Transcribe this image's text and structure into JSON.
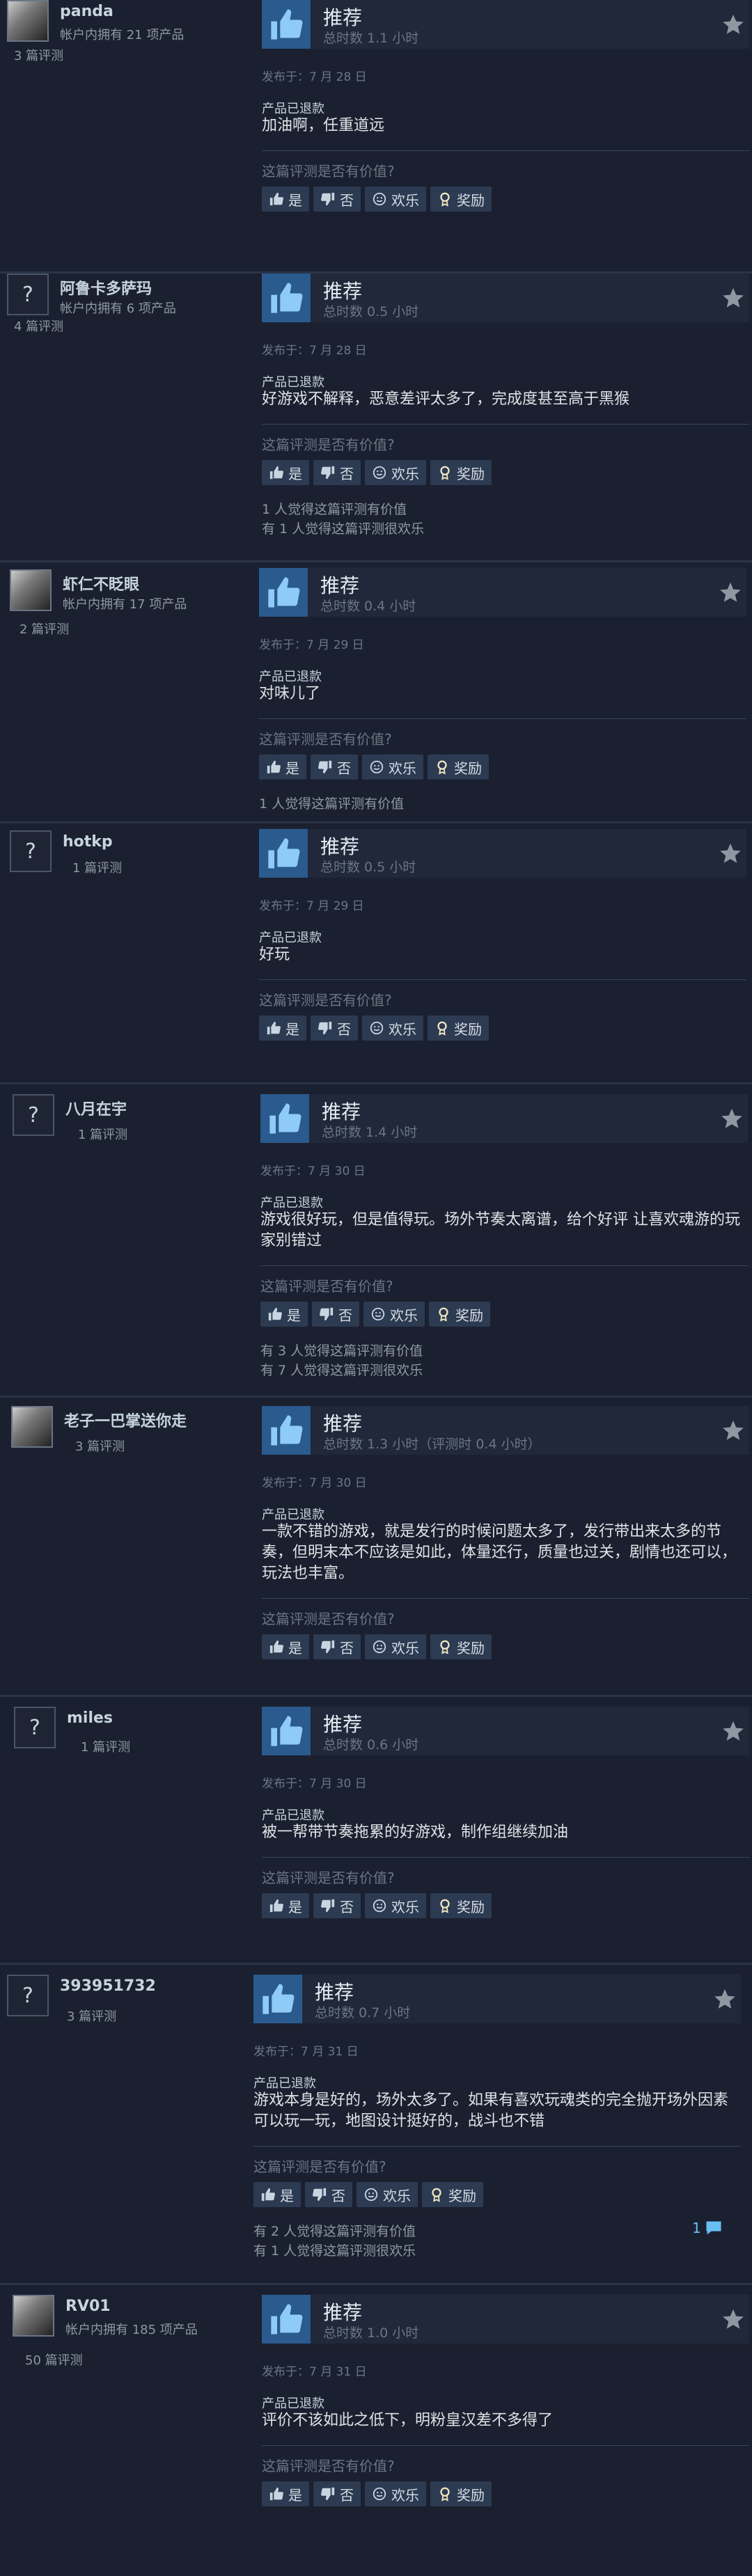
{
  "common": {
    "recommend": "推荐",
    "refunded": "产品已退款",
    "help_question": "这篇评测是否有价值?",
    "btn_yes": "是",
    "btn_no": "否",
    "btn_funny": "欢乐",
    "btn_award": "奖励"
  },
  "reviews": [
    {
      "username": "panda",
      "products": "帐户内拥有 21 项产品",
      "review_count": "3 篇评测",
      "hours": "总时数 1.1 小时",
      "date": "发布于：7 月 28 日",
      "body": "加油啊，任重道远",
      "stats": [],
      "avatar": "animal"
    },
    {
      "username": "阿鲁卡多萨玛",
      "products": "帐户内拥有 6 项产品",
      "review_count": "4 篇评测",
      "hours": "总时数 0.5 小时",
      "date": "发布于：7 月 28 日",
      "body": "好游戏不解释，恶意差评太多了，完成度甚至高于黑猴",
      "stats": [
        "1 人觉得这篇评测有价值",
        "有 1 人觉得这篇评测很欢乐"
      ],
      "avatar": "default"
    },
    {
      "username": "虾仁不眨眼",
      "products": "帐户内拥有 17 项产品",
      "review_count": "2 篇评测",
      "hours": "总时数 0.4 小时",
      "date": "发布于：7 月 29 日",
      "body": "对味儿了",
      "stats": [
        "1 人觉得这篇评测有价值"
      ],
      "avatar": "photo"
    },
    {
      "username": "hotkp",
      "products": "",
      "review_count": "1 篇评测",
      "hours": "总时数 0.5 小时",
      "date": "发布于：7 月 29 日",
      "body": "好玩",
      "stats": [],
      "avatar": "default"
    },
    {
      "username": "八月在宇",
      "products": "",
      "review_count": "1 篇评测",
      "hours": "总时数 1.4 小时",
      "date": "发布于：7 月 30 日",
      "body": "游戏很好玩，但是值得玩。场外节奏太离谱，给个好评 让喜欢魂游的玩家别错过",
      "stats": [
        "有 3 人觉得这篇评测有价值",
        "有 7 人觉得这篇评测很欢乐"
      ],
      "avatar": "default"
    },
    {
      "username": "老子一巴掌送你走",
      "products": "",
      "review_count": "3 篇评测",
      "hours": "总时数 1.3 小时（评测时 0.4 小时）",
      "date": "发布于：7 月 30 日",
      "body": "一款不错的游戏，就是发行的时候问题太多了，发行带出来太多的节奏，但明末本不应该是如此，体量还行，质量也过关，剧情也还可以，玩法也丰富。",
      "stats": [],
      "avatar": "animal"
    },
    {
      "username": "miles",
      "products": "",
      "review_count": "1 篇评测",
      "hours": "总时数 0.6 小时",
      "date": "发布于：7 月 30 日",
      "body": "被一帮带节奏拖累的好游戏，制作组继续加油",
      "stats": [],
      "avatar": "default"
    },
    {
      "username": "393951732",
      "products": "",
      "review_count": "3 篇评测",
      "hours": "总时数 0.7 小时",
      "date": "发布于：7 月 31 日",
      "body": "游戏本身是好的，场外太多了。如果有喜欢玩魂类的完全抛开场外因素可以玩一玩，地图设计挺好的，战斗也不错",
      "stats": [
        "有 2 人觉得这篇评测有价值",
        "有 1 人觉得这篇评测很欢乐"
      ],
      "comments": "1",
      "avatar": "default"
    },
    {
      "username": "RV01",
      "products": "帐户内拥有 185 项产品",
      "review_count": "50 篇评测",
      "hours": "总时数 1.0 小时",
      "date": "发布于：7 月 31 日",
      "body": "评价不该如此之低下，明粉皇汉差不多得了",
      "stats": [],
      "avatar": "photo2"
    }
  ]
}
